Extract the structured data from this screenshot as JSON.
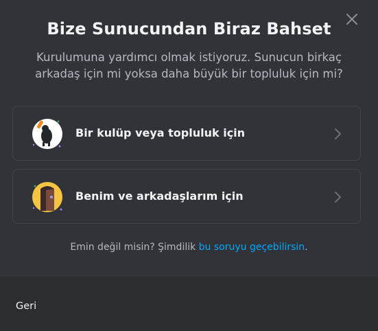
{
  "dialog": {
    "title": "Bize Sunucundan Biraz Bahset",
    "subtitle": "Kurulumuna yardımcı olmak istiyoruz. Sunucun birkaç arkadaş için mi yoksa daha büyük bir topluluk için mi?"
  },
  "options": [
    {
      "label": "Bir kulüp veya topluluk için",
      "icon": "club-community-icon"
    },
    {
      "label": "Benim ve arkadaşlarım için",
      "icon": "friends-door-icon"
    }
  ],
  "hint": {
    "text": "Emin değil misin? Şimdilik ",
    "link": "bu soruyu geçebilirsin",
    "suffix": "."
  },
  "footer": {
    "back_label": "Geri"
  },
  "colors": {
    "background": "#313338",
    "footer": "#2b2d31",
    "link": "#00a8fc",
    "text": "#f2f3f5",
    "muted": "#b5bac1"
  }
}
